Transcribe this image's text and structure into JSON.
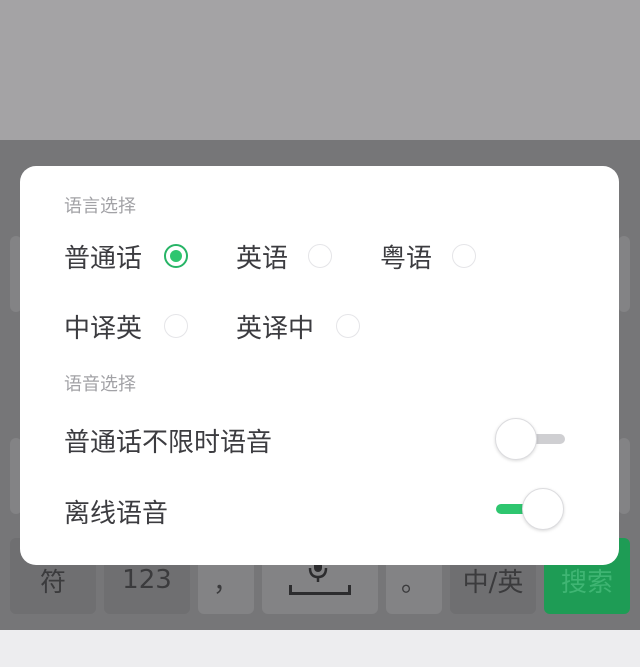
{
  "keyboard": {
    "bottom_row": {
      "symbols_label": "符",
      "numbers_label": "123",
      "comma_label": "，",
      "period_label": "。",
      "lang_switch_label": "中/英",
      "search_label": "搜索"
    }
  },
  "dialog": {
    "language_section": {
      "title": "语言选择",
      "options": [
        {
          "label": "普通话",
          "checked": true
        },
        {
          "label": "英语",
          "checked": false
        },
        {
          "label": "粤语",
          "checked": false
        },
        {
          "label": "中译英",
          "checked": false
        },
        {
          "label": "英译中",
          "checked": false
        }
      ]
    },
    "voice_section": {
      "title": "语音选择",
      "settings": [
        {
          "label": "普通话不限时语音",
          "enabled": false
        },
        {
          "label": "离线语音",
          "enabled": true
        }
      ]
    }
  },
  "colors": {
    "accent": "#2ec66f",
    "overlay": "#767678"
  }
}
